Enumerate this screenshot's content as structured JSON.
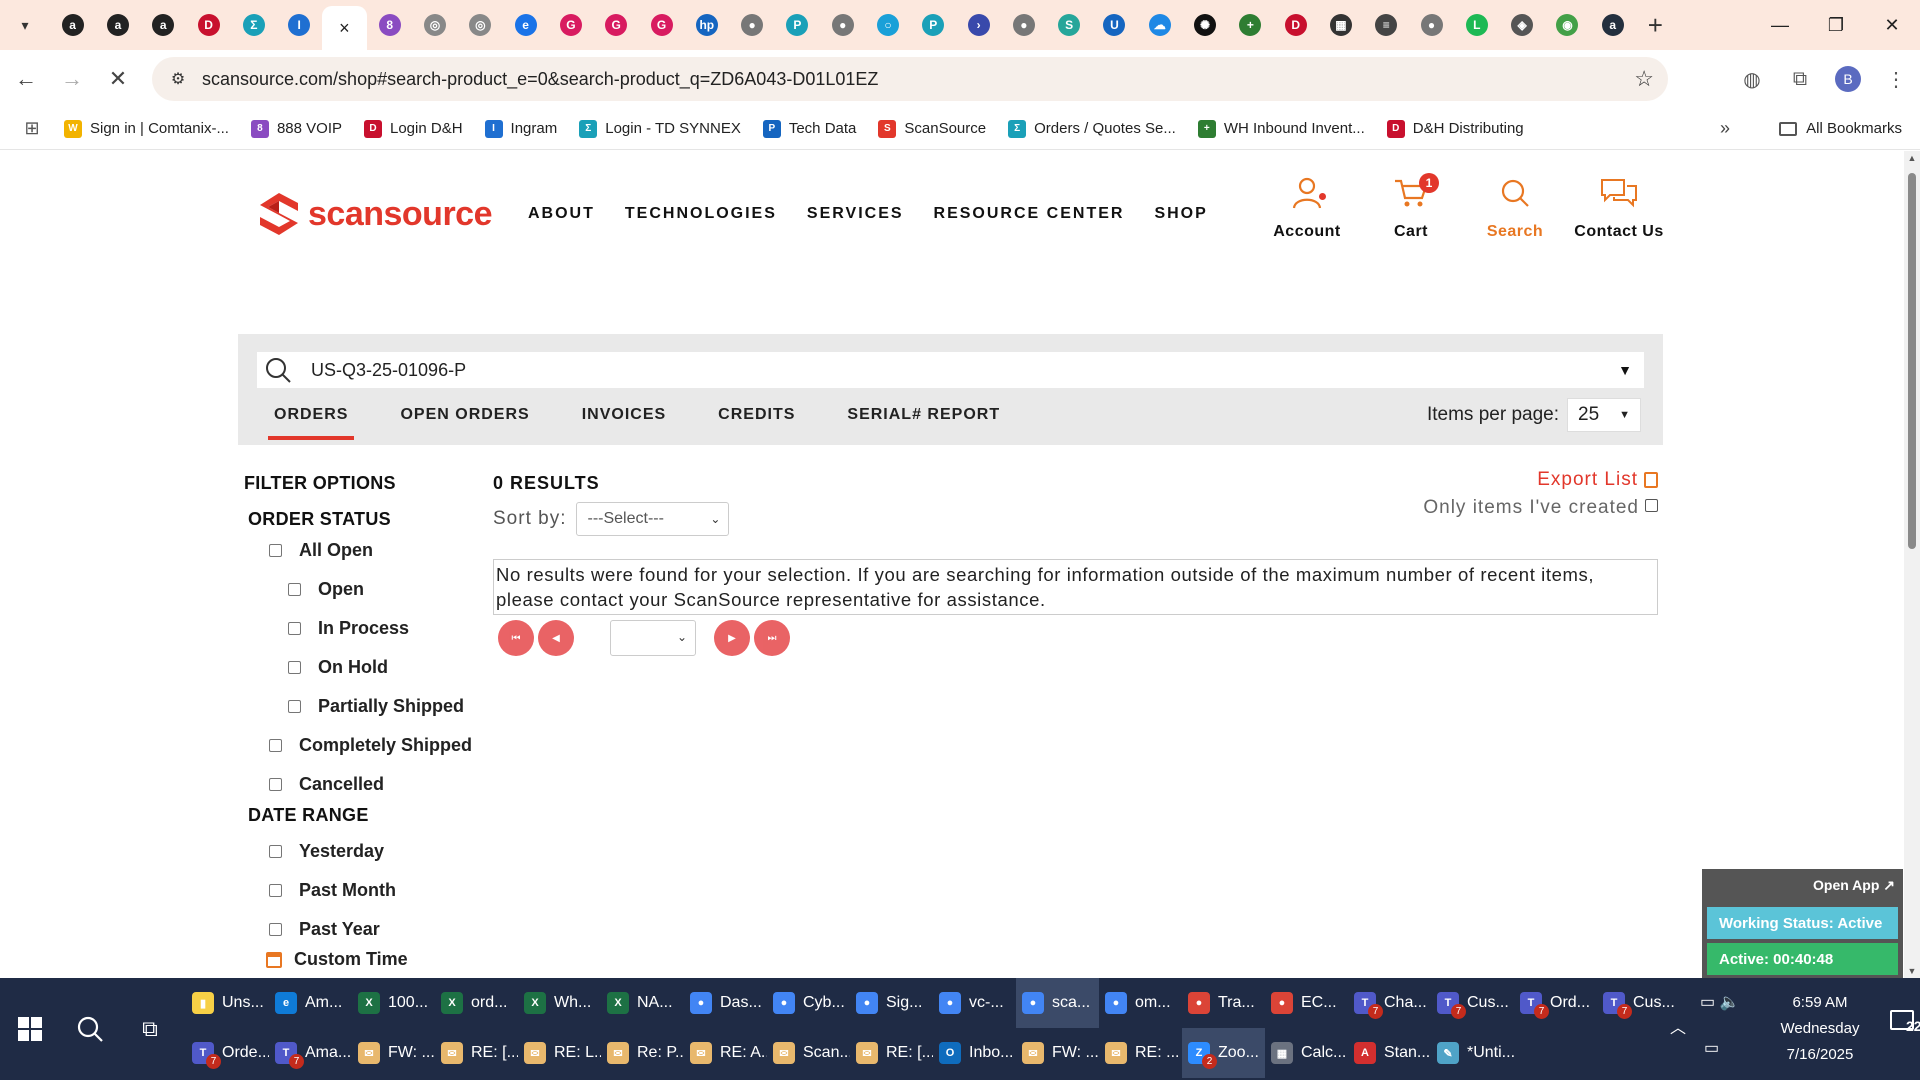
{
  "browser": {
    "url": "scansource.com/shop#search-product_e=0&search-product_q=ZD6A043-D01L01EZ",
    "tab_favicons": [
      {
        "name": "amazon-favicon",
        "glyph": "a",
        "color": "#222"
      },
      {
        "name": "amazon-favicon",
        "glyph": "a",
        "color": "#222"
      },
      {
        "name": "amazon-favicon",
        "glyph": "a",
        "color": "#222"
      },
      {
        "name": "dh-favicon",
        "glyph": "D",
        "color": "#c8102e"
      },
      {
        "name": "td-synnex-favicon",
        "glyph": "Σ",
        "color": "#1aa0b8"
      },
      {
        "name": "ingram-favicon",
        "glyph": "I",
        "color": "#1f6fd1"
      },
      {
        "name": "close-tab",
        "glyph": "×",
        "color": "transparent"
      },
      {
        "name": "voip-favicon",
        "glyph": "8",
        "color": "#8a4bc1"
      },
      {
        "name": "globe-favicon",
        "glyph": "◎",
        "color": "#888"
      },
      {
        "name": "globe-favicon",
        "glyph": "◎",
        "color": "#888"
      },
      {
        "name": "e-favicon",
        "glyph": "e",
        "color": "#1a73e8"
      },
      {
        "name": "red-circle-favicon",
        "glyph": "G",
        "color": "#d81b60"
      },
      {
        "name": "red-circle-favicon",
        "glyph": "G",
        "color": "#d81b60"
      },
      {
        "name": "red-circle-favicon",
        "glyph": "G",
        "color": "#d81b60"
      },
      {
        "name": "hp-favicon",
        "glyph": "hp",
        "color": "#1565c0"
      },
      {
        "name": "globe-favicon",
        "glyph": "●",
        "color": "#777"
      },
      {
        "name": "p-favicon",
        "glyph": "P",
        "color": "#1aa0b8"
      },
      {
        "name": "globe-favicon",
        "glyph": "●",
        "color": "#777"
      },
      {
        "name": "o-favicon",
        "glyph": "○",
        "color": "#1aa0d8"
      },
      {
        "name": "p-favicon",
        "glyph": "P",
        "color": "#1aa0b8"
      },
      {
        "name": "arrow-favicon",
        "glyph": "›",
        "color": "#3949ab"
      },
      {
        "name": "globe-favicon",
        "glyph": "●",
        "color": "#777"
      },
      {
        "name": "s-favicon",
        "glyph": "S",
        "color": "#26a69a"
      },
      {
        "name": "u-favicon",
        "glyph": "U",
        "color": "#1565c0"
      },
      {
        "name": "cloud-favicon",
        "glyph": "☁",
        "color": "#1e88e5"
      },
      {
        "name": "openai-favicon",
        "glyph": "✺",
        "color": "#111"
      },
      {
        "name": "plus-favicon",
        "glyph": "+",
        "color": "#2e7d32"
      },
      {
        "name": "dh-favicon",
        "glyph": "D",
        "color": "#c8102e"
      },
      {
        "name": "grid-favicon",
        "glyph": "▦",
        "color": "#333"
      },
      {
        "name": "bars-favicon",
        "glyph": "≡",
        "color": "#444"
      },
      {
        "name": "globe-favicon",
        "glyph": "●",
        "color": "#777"
      },
      {
        "name": "logi-favicon",
        "glyph": "L",
        "color": "#1db954"
      },
      {
        "name": "car-favicon",
        "glyph": "◈",
        "color": "#555"
      },
      {
        "name": "green-favicon",
        "glyph": "◉",
        "color": "#43a047"
      },
      {
        "name": "amazon-favicon",
        "glyph": "a",
        "color": "#232f3e"
      }
    ],
    "bookmarks": [
      {
        "label": "Sign in | Comtanix-...",
        "glyph": "W",
        "color": "#f2b300"
      },
      {
        "label": "888 VOIP",
        "glyph": "8",
        "color": "#8a4bc1"
      },
      {
        "label": "Login D&H",
        "glyph": "D",
        "color": "#c8102e"
      },
      {
        "label": "Ingram",
        "glyph": "I",
        "color": "#1f6fd1"
      },
      {
        "label": "Login - TD SYNNEX",
        "glyph": "Σ",
        "color": "#1aa0b8"
      },
      {
        "label": "Tech Data",
        "glyph": "P",
        "color": "#1565c0"
      },
      {
        "label": "ScanSource",
        "glyph": "S",
        "color": "#e2372b"
      },
      {
        "label": "Orders / Quotes Se...",
        "glyph": "Σ",
        "color": "#1aa0b8"
      },
      {
        "label": "WH Inbound Invent...",
        "glyph": "+",
        "color": "#2e7d32"
      },
      {
        "label": "D&H Distributing",
        "glyph": "D",
        "color": "#c8102e"
      }
    ],
    "all_bookmarks": "All Bookmarks",
    "profile_initial": "B"
  },
  "site": {
    "logo_text": "scansource",
    "nav": [
      "ABOUT",
      "TECHNOLOGIES",
      "SERVICES",
      "RESOURCE CENTER",
      "SHOP"
    ],
    "account_label": "Account",
    "cart_label": "Cart",
    "cart_count": "1",
    "search_label": "Search",
    "contact_label": "Contact Us"
  },
  "search": {
    "value": "US-Q3-25-01096-P",
    "tabs": [
      "ORDERS",
      "OPEN ORDERS",
      "INVOICES",
      "CREDITS",
      "SERIAL# REPORT"
    ],
    "items_per_page_label": "Items per page:",
    "items_per_page": "25"
  },
  "filters": {
    "heading": "FILTER OPTIONS",
    "order_status_heading": "ORDER STATUS",
    "all_open": "All Open",
    "open": "Open",
    "in_process": "In Process",
    "on_hold": "On Hold",
    "partially_shipped": "Partially Shipped",
    "completely_shipped": "Completely Shipped",
    "cancelled": "Cancelled",
    "date_range_heading": "DATE RANGE",
    "yesterday": "Yesterday",
    "past_month": "Past Month",
    "past_year": "Past Year",
    "custom_time": "Custom Time"
  },
  "results": {
    "count": "0 RESULTS",
    "sort_label": "Sort by:",
    "sort_value": "---Select---",
    "export": "Export List",
    "only_mine": "Only items I've created",
    "message": "No results were found for your selection. If you are searching for information outside of the maximum number of recent items, please contact your ScanSource representative for assistance."
  },
  "widget": {
    "open_app": "Open App ↗",
    "working_status": "Working Status: Active",
    "active_time": "Active: 00:40:48"
  },
  "taskbar": {
    "row1": [
      {
        "label": "Uns...",
        "glyph": "▮",
        "color": "#f7d046",
        "badge": ""
      },
      {
        "label": "Am...",
        "glyph": "e",
        "color": "#0f7bd7",
        "badge": ""
      },
      {
        "label": "100...",
        "glyph": "X",
        "color": "#1d7144",
        "badge": ""
      },
      {
        "label": "ord...",
        "glyph": "X",
        "color": "#1d7144",
        "badge": ""
      },
      {
        "label": "Wh...",
        "glyph": "X",
        "color": "#1d7144",
        "badge": ""
      },
      {
        "label": "NA...",
        "glyph": "X",
        "color": "#1d7144",
        "badge": ""
      },
      {
        "label": "Das...",
        "glyph": "●",
        "color": "#4285f4",
        "badge": ""
      },
      {
        "label": "Cyb...",
        "glyph": "●",
        "color": "#4285f4",
        "badge": ""
      },
      {
        "label": "Sig...",
        "glyph": "●",
        "color": "#4285f4",
        "badge": ""
      },
      {
        "label": "vc-...",
        "glyph": "●",
        "color": "#4285f4",
        "badge": ""
      },
      {
        "label": "sca...",
        "glyph": "●",
        "color": "#4285f4",
        "badge": ""
      },
      {
        "label": "om...",
        "glyph": "●",
        "color": "#4285f4",
        "badge": ""
      },
      {
        "label": "Tra...",
        "glyph": "●",
        "color": "#db4437",
        "badge": ""
      },
      {
        "label": "EC...",
        "glyph": "●",
        "color": "#db4437",
        "badge": ""
      },
      {
        "label": "Cha...",
        "glyph": "T",
        "color": "#5059c9",
        "badge": "7"
      },
      {
        "label": "Cus...",
        "glyph": "T",
        "color": "#5059c9",
        "badge": "7"
      },
      {
        "label": "Ord...",
        "glyph": "T",
        "color": "#5059c9",
        "badge": "7"
      },
      {
        "label": "Cus...",
        "glyph": "T",
        "color": "#5059c9",
        "badge": "7"
      }
    ],
    "row2": [
      {
        "label": "Orde...",
        "glyph": "T",
        "color": "#5059c9",
        "badge": "7"
      },
      {
        "label": "Ama...",
        "glyph": "T",
        "color": "#5059c9",
        "badge": "7"
      },
      {
        "label": "FW: ...",
        "glyph": "✉",
        "color": "#e8b86d",
        "badge": ""
      },
      {
        "label": "RE: [...",
        "glyph": "✉",
        "color": "#e8b86d",
        "badge": ""
      },
      {
        "label": "RE: L...",
        "glyph": "✉",
        "color": "#e8b86d",
        "badge": ""
      },
      {
        "label": "Re: P...",
        "glyph": "✉",
        "color": "#e8b86d",
        "badge": ""
      },
      {
        "label": "RE: A...",
        "glyph": "✉",
        "color": "#e8b86d",
        "badge": ""
      },
      {
        "label": "Scan...",
        "glyph": "✉",
        "color": "#e8b86d",
        "badge": ""
      },
      {
        "label": "RE: [...",
        "glyph": "✉",
        "color": "#e8b86d",
        "badge": ""
      },
      {
        "label": "Inbo...",
        "glyph": "O",
        "color": "#0f6cbd",
        "badge": ""
      },
      {
        "label": "FW: ...",
        "glyph": "✉",
        "color": "#e8b86d",
        "badge": ""
      },
      {
        "label": "RE: ...",
        "glyph": "✉",
        "color": "#e8b86d",
        "badge": ""
      },
      {
        "label": "Zoo...",
        "glyph": "Z",
        "color": "#2d8cff",
        "badge": "2"
      },
      {
        "label": "Calc...",
        "glyph": "▦",
        "color": "#6b7280",
        "badge": ""
      },
      {
        "label": "Stan...",
        "glyph": "A",
        "color": "#d32f2f",
        "badge": ""
      },
      {
        "label": "*Unti...",
        "glyph": "✎",
        "color": "#4fa3c7",
        "badge": ""
      }
    ],
    "time": "6:59 AM",
    "day": "Wednesday",
    "date": "7/16/2025",
    "notifications": "22"
  }
}
